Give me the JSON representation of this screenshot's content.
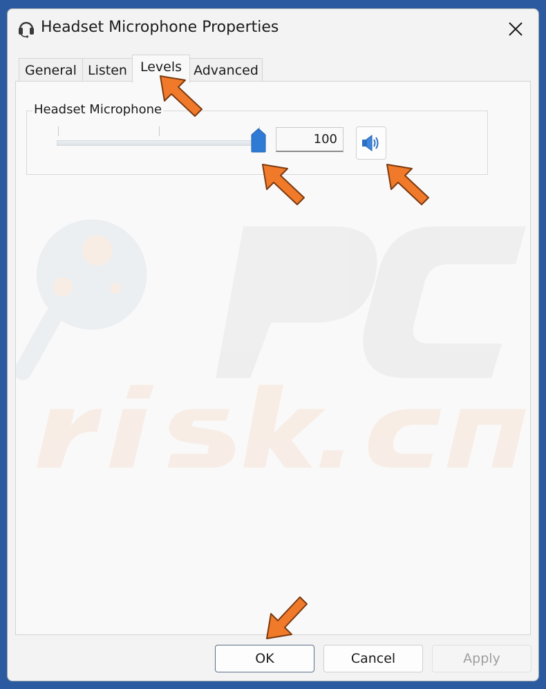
{
  "window": {
    "title": "Headset Microphone Properties",
    "title_icon": "headset-icon",
    "close_icon": "close-icon"
  },
  "tabs": [
    {
      "label": "General",
      "active": false
    },
    {
      "label": "Listen",
      "active": false
    },
    {
      "label": "Levels",
      "active": true
    },
    {
      "label": "Advanced",
      "active": false
    }
  ],
  "levels": {
    "group_label": "Headset Microphone",
    "level_value": "100",
    "slider_fraction": 1.0,
    "mute_icon": "speaker-icon"
  },
  "buttons": {
    "ok": "OK",
    "cancel": "Cancel",
    "apply": "Apply"
  },
  "colors": {
    "accent": "#2e7bd6",
    "annotation_arrow": "#f07a2a"
  }
}
